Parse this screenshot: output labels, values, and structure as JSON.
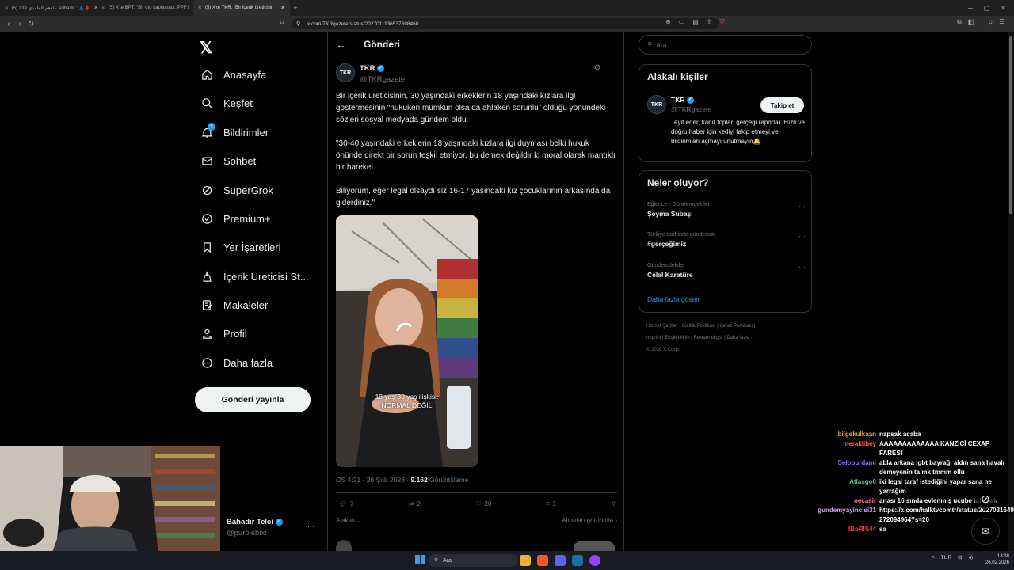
{
  "browser": {
    "tabs": [
      {
        "label": "(5) X'te ادهم العامدي - Adhami: \"👗💄"
      },
      {
        "label": "(5) X'te BPT: \"Bir oto kaplamacı, PPF i"
      },
      {
        "label": "(5) X'te TKR: \"Bir içerik üreticisin"
      }
    ],
    "new_tab": "+",
    "url": "x.com/TKRgazete/status/2027011136537698460"
  },
  "sidebar": {
    "logo": "𝕏",
    "items": [
      {
        "label": "Anasayfa",
        "icon": "home-icon"
      },
      {
        "label": "Keşfet",
        "icon": "search-icon"
      },
      {
        "label": "Bildirimler",
        "icon": "bell-icon",
        "badge": "5"
      },
      {
        "label": "Sohbet",
        "icon": "mail-icon"
      },
      {
        "label": "SuperGrok",
        "icon": "grok-icon"
      },
      {
        "label": "Premium+",
        "icon": "premium-icon"
      },
      {
        "label": "Yer İşaretleri",
        "icon": "bookmark-icon"
      },
      {
        "label": "İçerik Üreticisi St...",
        "icon": "creator-icon"
      },
      {
        "label": "Makaleler",
        "icon": "article-icon"
      },
      {
        "label": "Profil",
        "icon": "profile-icon"
      },
      {
        "label": "Daha fazla",
        "icon": "more-circle-icon"
      }
    ],
    "post_button": "Gönderi yayınla",
    "user": {
      "name": "Bahadır Telci",
      "handle": "@purplebixi"
    }
  },
  "main": {
    "title": "Gönderi",
    "tweet": {
      "author": "TKR",
      "handle": "@TKRgazete",
      "avatar_text": "TKR",
      "text": "Bir içerik üreticisinin, 30 yaşındaki erkeklerin 18 yaşındaki kızlara ilgi göstermesinin “hukuken mümkün olsa da ahlaken sorunlu” olduğu yönündeki sözleri sosyal medyada gündem oldu:\n\n\"30-40 yaşındaki erkeklerin 18 yaşındaki kızlara ilgi duyması belki hukuk önünde direkt bir sorun teşkil etmiyor, bu demek değildir ki moral olarak mantıklı bir hareket.\n\nBiliyorum, eğer legal olsaydı siz 16-17 yaşındaki kız çocuklarının arkasında da giderdiniz.\"",
      "media_caption_1": "18 yaş-30 yaş ilişkisi:",
      "media_caption_2": "NORMAL DEĞİL",
      "time": "ÖS 4:21 · 26 Şub 2026 · ",
      "views": "9.162",
      "views_label": " Görüntüleme",
      "replies": "3",
      "reposts": "2",
      "likes": "20",
      "bookmarks": "1",
      "relevance": "Alakalı",
      "quotes_link": "Alıntıları görüntüle"
    }
  },
  "right": {
    "search_placeholder": "Ara",
    "related_title": "Alakalı kişiler",
    "related": {
      "name": "TKR",
      "handle": "@TKRgazete",
      "bio": "Teyit eder, kanıt toplar, gerçeği raporlar. Hızlı ve doğru haber için kediyi takip etmeyi ve bildirimleri açmayı unutmayın🔔",
      "follow": "Takip et"
    },
    "trends_title": "Neler oluyor?",
    "trends": [
      {
        "category": "Eğlence · Gündemdekiler",
        "name": "Şeyma Subaşı"
      },
      {
        "category": "Türkiye tarihinde gündemde",
        "name": "#gerçeğimiz"
      },
      {
        "category": "Gündemdekiler",
        "name": "Celal Karatüre"
      }
    ],
    "show_more": "Daha fazla göster",
    "footer_1": "Hizmet Şartları  |  Gizlilik Politikası  |  Çerez Politikası  |",
    "footer_2": "Imprint  |  Erişilebilirlik  |  Reklam bilgisi  |  Daha fazla ···",
    "footer_3": "© 2026 X Corp."
  },
  "chat": [
    {
      "user": "bilgekulkaan",
      "color": "#e6a830",
      "msg": "napsak acaba"
    },
    {
      "user": "meraklibey",
      "color": "#ff6a3d",
      "msg": "AAAAAAAAAAAAA KANZİCİ CEXAP FARESİ"
    },
    {
      "user": "Seloburdami",
      "color": "#9b6cff",
      "msg": "abla arkana lgbt bayrağı aldın sana havalı demeyenin ta mk tmmm ollu"
    },
    {
      "user": "Atlasgo0",
      "color": "#3ad18b",
      "msg": "iki legal taraf istediğini yapar sana ne yarrağım"
    },
    {
      "user": "necasir",
      "color": "#ff7aa0",
      "msg": "anası 16 sında evlenmiş ucube lafa bak"
    },
    {
      "user": "gundemyayincisi31",
      "color": "#d3a0ff",
      "msg": "https://x.com/halktvcomtr/status/2027031649272094964?s=20"
    },
    {
      "user": "IBoRIS44",
      "color": "#ff3b3b",
      "msg": "sa"
    }
  ],
  "taskbar": {
    "search": "Ara",
    "lang": "TUR",
    "time": "18:38",
    "date": "26.02.2026"
  }
}
